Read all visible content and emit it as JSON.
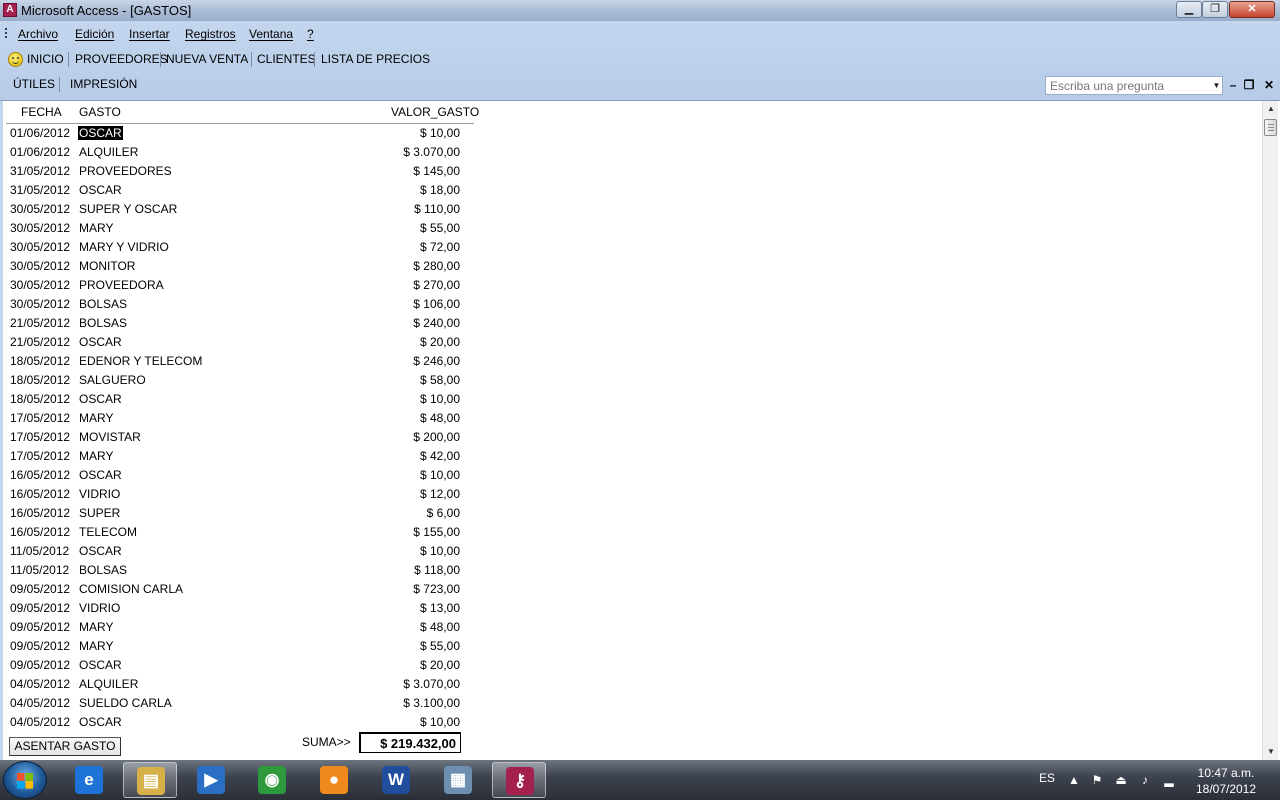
{
  "window": {
    "title": "Microsoft Access - [GASTOS]",
    "controls": {
      "minimize": "▁",
      "maximize": "❐",
      "close": "✕"
    }
  },
  "menubar": {
    "items": [
      "Archivo",
      "Edición",
      "Insertar",
      "Registros",
      "Ventana",
      "?"
    ]
  },
  "toolbar1": {
    "items": [
      "INICIO",
      "PROVEEDORES",
      "NUEVA VENTA",
      "CLIENTES",
      "LISTA DE PRECIOS"
    ]
  },
  "toolbar2": {
    "items": [
      "ÚTILES",
      "IMPRESIÓN"
    ]
  },
  "help": {
    "placeholder": "Escriba una pregunta",
    "mdi_min": "–",
    "mdi_restore": "❐",
    "mdi_close": "✕"
  },
  "table": {
    "headers": {
      "fecha": "FECHA",
      "gasto": "GASTO",
      "valor": "VALOR_GASTO"
    },
    "rows": [
      {
        "fecha": "01/06/2012",
        "gasto": "OSCAR",
        "valor": "$ 10,00"
      },
      {
        "fecha": "01/06/2012",
        "gasto": "ALQUILER",
        "valor": "$ 3.070,00"
      },
      {
        "fecha": "31/05/2012",
        "gasto": "PROVEEDORES",
        "valor": "$ 145,00"
      },
      {
        "fecha": "31/05/2012",
        "gasto": "OSCAR",
        "valor": "$ 18,00"
      },
      {
        "fecha": "30/05/2012",
        "gasto": "SUPER Y OSCAR",
        "valor": "$ 110,00"
      },
      {
        "fecha": "30/05/2012",
        "gasto": "MARY",
        "valor": "$ 55,00"
      },
      {
        "fecha": "30/05/2012",
        "gasto": "MARY Y VIDRIO",
        "valor": "$ 72,00"
      },
      {
        "fecha": "30/05/2012",
        "gasto": "MONITOR",
        "valor": "$ 280,00"
      },
      {
        "fecha": "30/05/2012",
        "gasto": "PROVEEDORA",
        "valor": "$ 270,00"
      },
      {
        "fecha": "30/05/2012",
        "gasto": "BOLSAS",
        "valor": "$ 106,00"
      },
      {
        "fecha": "21/05/2012",
        "gasto": "BOLSAS",
        "valor": "$ 240,00"
      },
      {
        "fecha": "21/05/2012",
        "gasto": "OSCAR",
        "valor": "$ 20,00"
      },
      {
        "fecha": "18/05/2012",
        "gasto": "EDENOR Y TELECOM",
        "valor": "$ 246,00"
      },
      {
        "fecha": "18/05/2012",
        "gasto": "SALGUERO",
        "valor": "$ 58,00"
      },
      {
        "fecha": "18/05/2012",
        "gasto": "OSCAR",
        "valor": "$ 10,00"
      },
      {
        "fecha": "17/05/2012",
        "gasto": "MARY",
        "valor": "$ 48,00"
      },
      {
        "fecha": "17/05/2012",
        "gasto": "MOVISTAR",
        "valor": "$ 200,00"
      },
      {
        "fecha": "17/05/2012",
        "gasto": "MARY",
        "valor": "$ 42,00"
      },
      {
        "fecha": "16/05/2012",
        "gasto": "OSCAR",
        "valor": "$ 10,00"
      },
      {
        "fecha": "16/05/2012",
        "gasto": "VIDRIO",
        "valor": "$ 12,00"
      },
      {
        "fecha": "16/05/2012",
        "gasto": "SUPER",
        "valor": "$ 6,00"
      },
      {
        "fecha": "16/05/2012",
        "gasto": "TELECOM",
        "valor": "$ 155,00"
      },
      {
        "fecha": "11/05/2012",
        "gasto": "OSCAR",
        "valor": "$ 10,00"
      },
      {
        "fecha": "11/05/2012",
        "gasto": "BOLSAS",
        "valor": "$ 118,00"
      },
      {
        "fecha": "09/05/2012",
        "gasto": "COMISION CARLA",
        "valor": "$ 723,00"
      },
      {
        "fecha": "09/05/2012",
        "gasto": "VIDRIO",
        "valor": "$ 13,00"
      },
      {
        "fecha": "09/05/2012",
        "gasto": "MARY",
        "valor": "$ 48,00"
      },
      {
        "fecha": "09/05/2012",
        "gasto": "MARY",
        "valor": "$ 55,00"
      },
      {
        "fecha": "09/05/2012",
        "gasto": "OSCAR",
        "valor": "$ 20,00"
      },
      {
        "fecha": "04/05/2012",
        "gasto": "ALQUILER",
        "valor": "$ 3.070,00"
      },
      {
        "fecha": "04/05/2012",
        "gasto": "SUELDO CARLA",
        "valor": "$ 3.100,00"
      },
      {
        "fecha": "04/05/2012",
        "gasto": "OSCAR",
        "valor": "$ 10,00"
      }
    ],
    "selected_row": 0
  },
  "footer": {
    "asentar_label": "ASENTAR GASTO",
    "suma_label": "SUMA>>",
    "suma_value": "$ 219.432,00"
  },
  "taskbar": {
    "apps": [
      {
        "name": "internet-explorer-icon",
        "glyph": "e",
        "color": "#1e73d8",
        "active": false
      },
      {
        "name": "file-explorer-icon",
        "glyph": "▤",
        "color": "#d7b04a",
        "active": true
      },
      {
        "name": "media-player-icon",
        "glyph": "▶",
        "color": "#2b6fc4",
        "active": false
      },
      {
        "name": "chrome-icon",
        "glyph": "◉",
        "color": "#2f9a3b",
        "active": false
      },
      {
        "name": "messenger-icon",
        "glyph": "●",
        "color": "#f08a1c",
        "active": false
      },
      {
        "name": "word-icon",
        "glyph": "W",
        "color": "#1f4e9c",
        "active": false
      },
      {
        "name": "calculator-icon",
        "glyph": "▦",
        "color": "#6e8fb0",
        "active": false
      },
      {
        "name": "access-icon",
        "glyph": "⚷",
        "color": "#a4204f",
        "active": true
      }
    ],
    "language": "ES",
    "time": "10:47 a.m.",
    "date": "18/07/2012"
  }
}
